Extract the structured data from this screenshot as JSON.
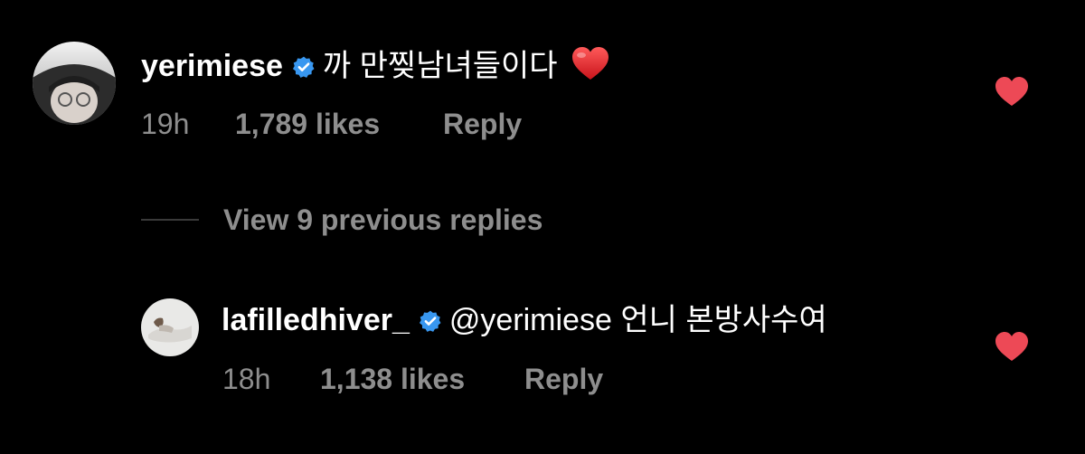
{
  "comments": [
    {
      "username": "yerimiese",
      "text": "까 만찢남녀들이다",
      "emoji": "heart-emoji",
      "time": "19h",
      "likes": "1,789 likes",
      "reply_label": "Reply",
      "verified": true,
      "liked": true
    },
    {
      "username": "lafilledhiver_",
      "mention": "@yerimiese",
      "text": "언니 본방사수여",
      "time": "18h",
      "likes": "1,138 likes",
      "reply_label": "Reply",
      "verified": true,
      "liked": true
    }
  ],
  "view_replies": {
    "label": "View 9 previous replies"
  },
  "colors": {
    "background": "#000000",
    "text": "#ffffff",
    "muted": "#8e8e8e",
    "verified": "#3897f0",
    "like_heart": "#ed4956"
  }
}
